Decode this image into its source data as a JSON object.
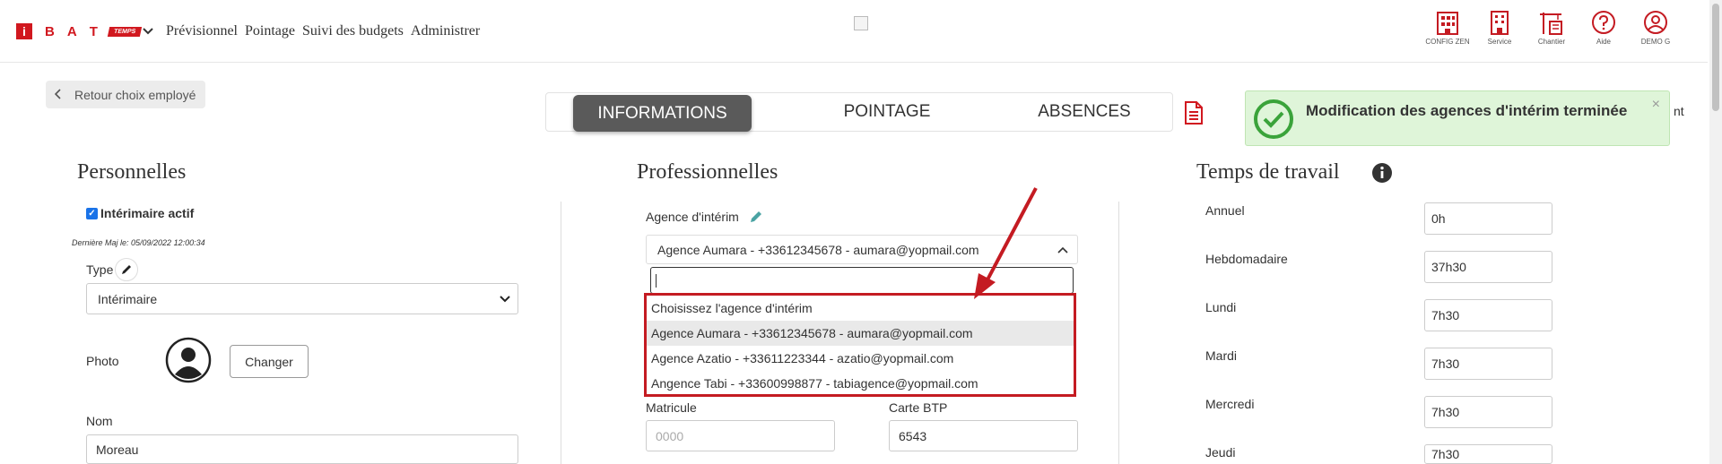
{
  "brand": {
    "letters": [
      "B",
      "A",
      "T"
    ],
    "i": "i",
    "badge": "TEMPS"
  },
  "nav": {
    "items": [
      "Prévisionnel",
      "Pointage",
      "Suivi des budgets",
      "Administrer"
    ]
  },
  "top_icons": [
    {
      "name": "config-zen-icon",
      "label": "CONFIG ZEN"
    },
    {
      "name": "service-icon",
      "label": "Service"
    },
    {
      "name": "chantier-icon",
      "label": "Chantier"
    },
    {
      "name": "aide-icon",
      "label": "Aide"
    },
    {
      "name": "user-icon",
      "label": "DEMO G"
    }
  ],
  "back_button": "Retour choix employé",
  "tabs": [
    "INFORMATIONS",
    "POINTAGE",
    "ABSENCES"
  ],
  "active_tab": "INFORMATIONS",
  "partial_text": "nt",
  "toast": {
    "message": "Modification des agences d'intérim terminée",
    "close": "×"
  },
  "personnelles": {
    "title": "Personnelles",
    "interimaire_label": "Intérimaire actif",
    "interimaire_checked": true,
    "last_update": "Dernière Maj le: 05/09/2022 12:00:34",
    "type_label": "Type",
    "type_value": "Intérimaire",
    "photo_label": "Photo",
    "change_button": "Changer",
    "nom_label": "Nom",
    "nom_value": "Moreau"
  },
  "professionnelles": {
    "title": "Professionnelles",
    "agence_label": "Agence d'intérim",
    "agence_value": "Agence Aumara - +33612345678 - aumara@yopmail.com",
    "search_value": "",
    "options": [
      "Choisissez l'agence d'intérim",
      "Agence Aumara - +33612345678 - aumara@yopmail.com",
      "Agence Azatio - +33611223344 - azatio@yopmail.com",
      "Angence Tabi - +33600998877 - tabiagence@yopmail.com"
    ],
    "highlighted_option": 1,
    "matricule_label": "Matricule",
    "matricule_placeholder": "0000",
    "carte_label": "Carte BTP",
    "carte_value": "6543"
  },
  "temps": {
    "title": "Temps de travail",
    "rows": [
      {
        "label": "Annuel",
        "value": "0h"
      },
      {
        "label": "Hebdomadaire",
        "value": "37h30"
      },
      {
        "label": "Lundi",
        "value": "7h30"
      },
      {
        "label": "Mardi",
        "value": "7h30"
      },
      {
        "label": "Mercredi",
        "value": "7h30"
      },
      {
        "label": "Jeudi",
        "value": "7h30"
      }
    ]
  },
  "colors": {
    "brand_red": "#d1181f",
    "toast_bg": "#dff5d9",
    "toast_check": "#3aa33a",
    "annotation_red": "#c41b22",
    "active_tab_bg": "#5a5a5a"
  }
}
